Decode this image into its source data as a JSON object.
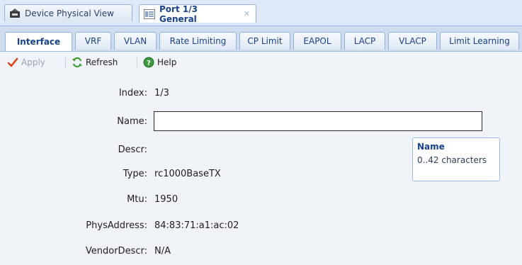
{
  "doc_tabs": [
    {
      "label": "Device Physical View",
      "icon": "device-icon",
      "active": false
    },
    {
      "label": "Port 1/3 General",
      "icon": "panel-icon",
      "active": true,
      "close": "✕"
    }
  ],
  "sub_tabs": [
    "Interface",
    "VRF",
    "VLAN",
    "Rate Limiting",
    "CP Limit",
    "EAPOL",
    "LACP",
    "VLACP",
    "Limit Learning"
  ],
  "toolbar": {
    "apply_label": "Apply",
    "refresh_label": "Refresh",
    "help_label": "Help"
  },
  "form": {
    "index_label": "Index:",
    "index_value": "1/3",
    "name_label": "Name:",
    "name_value": "",
    "descr_label": "Descr:",
    "descr_value": "",
    "type_label": "Type:",
    "type_value": "rc1000BaseTX",
    "mtu_label": "Mtu:",
    "mtu_value": "1950",
    "phys_label": "PhysAddress:",
    "phys_value": "84:83:71:a1:ac:02",
    "vendor_label": "VendorDescr:",
    "vendor_value": "N/A"
  },
  "tooltip": {
    "title": "Name",
    "body": "0..42 characters"
  },
  "colors": {
    "accent": "#15428b",
    "border": "#99bbe8",
    "apply_check": "#d9451b",
    "refresh": "#3a9a2a",
    "help": "#3c9a3c"
  }
}
